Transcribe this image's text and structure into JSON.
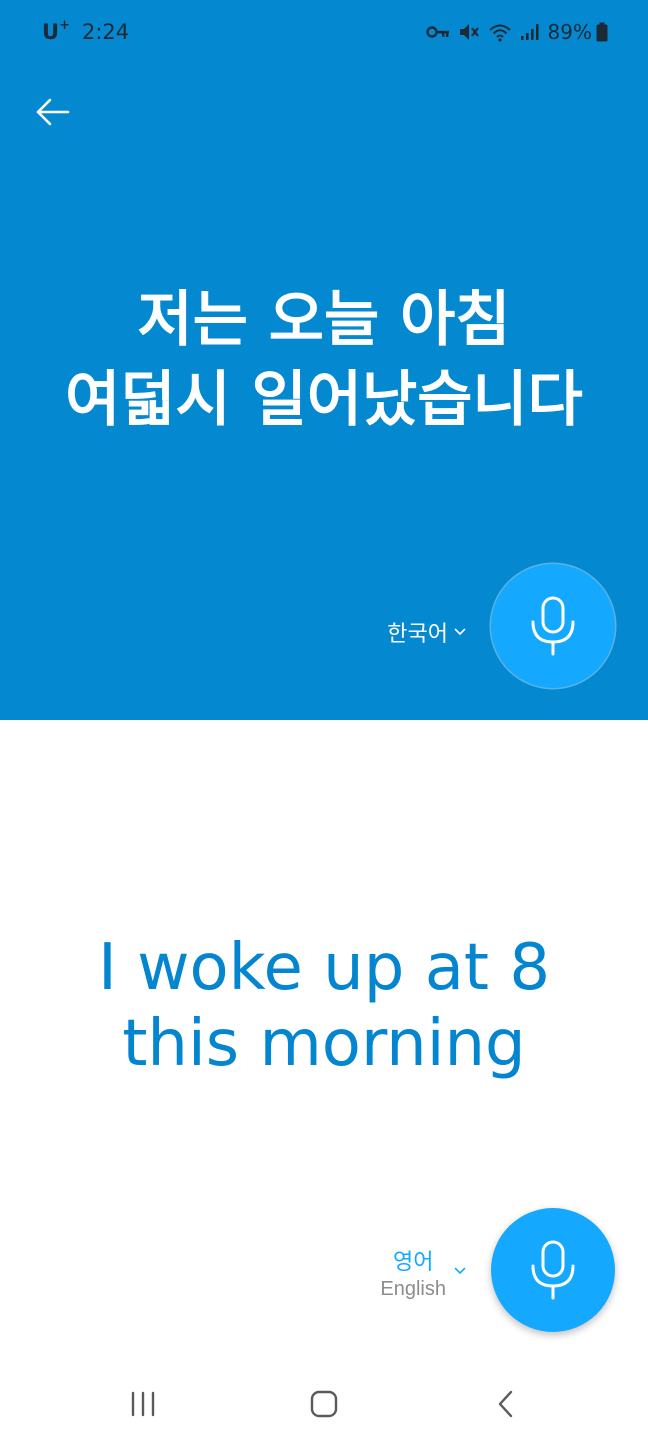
{
  "status_bar": {
    "carrier": "U",
    "carrier_sup": "+",
    "time": "2:24",
    "battery_percent": "89%",
    "icons": [
      "vpn-key-icon",
      "mute-icon",
      "wifi-icon",
      "signal-icon",
      "battery-icon"
    ]
  },
  "source": {
    "line1": "저는 오늘 아침",
    "line2": "여덟시 일어났습니다",
    "language": "한국어"
  },
  "target": {
    "line1": "I woke up at 8",
    "line2": "this morning",
    "language_native": "영어",
    "language_english": "English"
  },
  "colors": {
    "top_background": "#0489d1",
    "mic_button": "#14a8ff",
    "target_text": "#0485cf",
    "secondary_text": "#8c8c8c"
  },
  "nav": {
    "icons": [
      "recent-apps-icon",
      "home-icon",
      "back-nav-icon"
    ]
  }
}
